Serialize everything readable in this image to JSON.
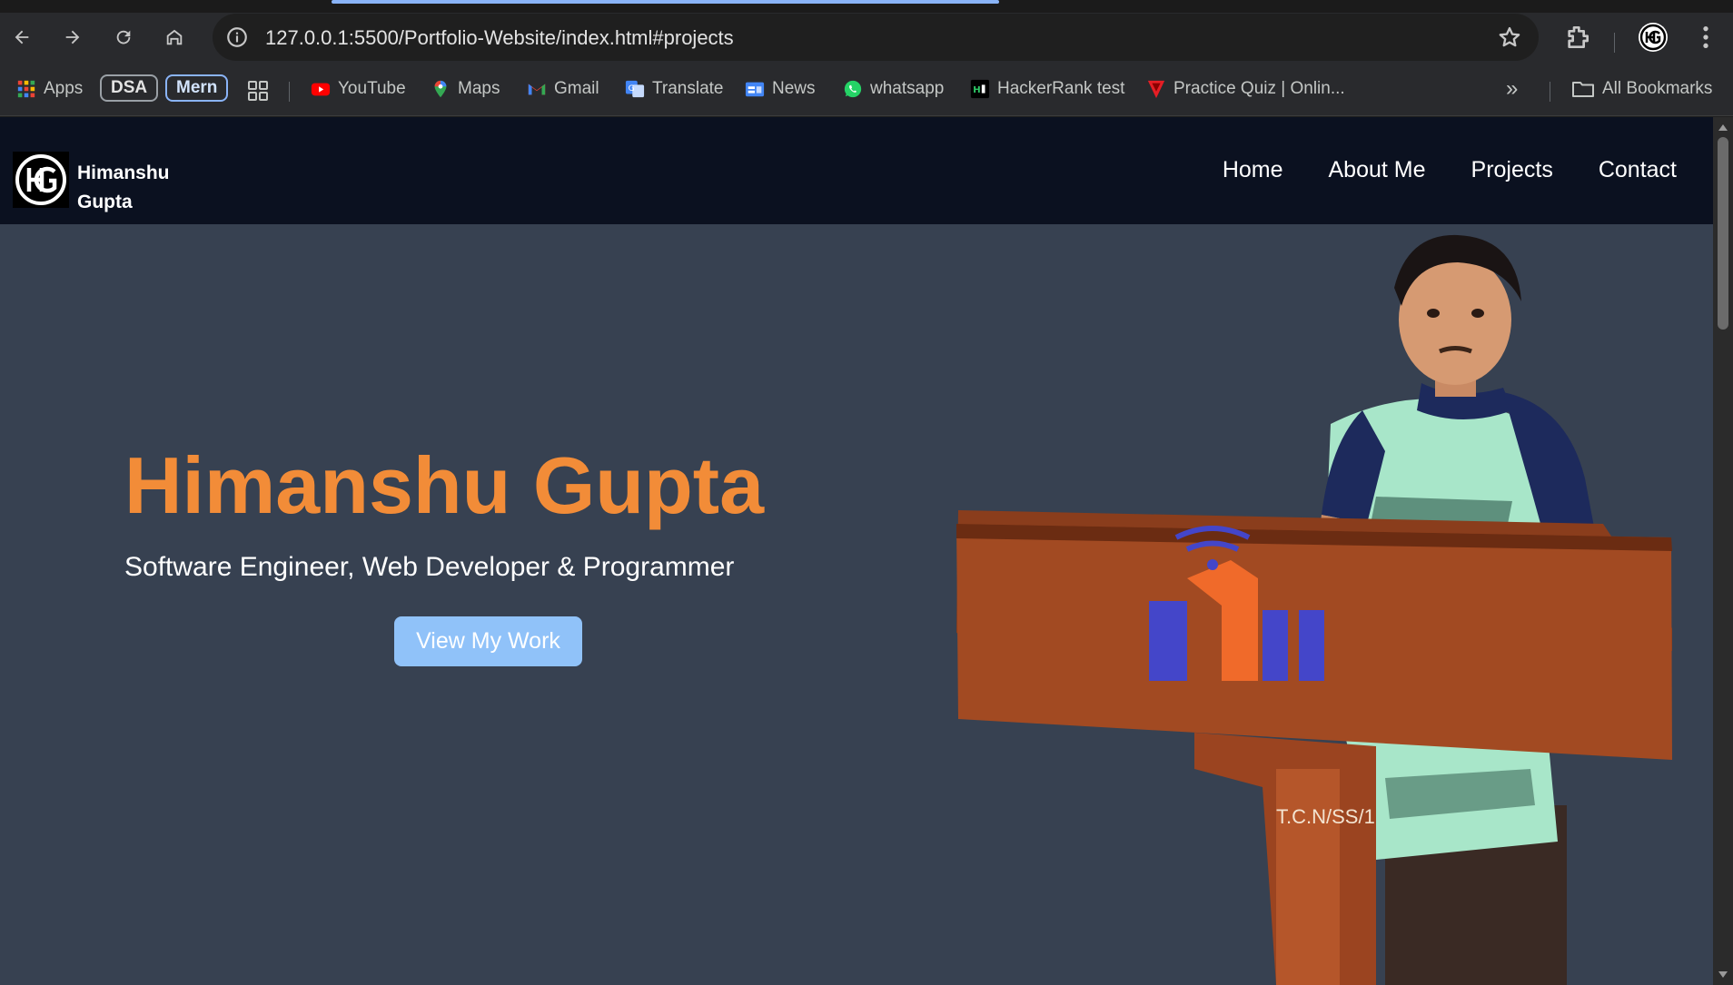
{
  "browser": {
    "url": "127.0.0.1:5500/Portfolio-Website/index.html#projects",
    "bookmarks": [
      {
        "label": "Apps",
        "icon": "apps-grid-icon"
      },
      {
        "label": "DSA",
        "icon": ""
      },
      {
        "label": "Mern",
        "icon": ""
      },
      {
        "label": "YouTube",
        "icon": "youtube-icon"
      },
      {
        "label": "Maps",
        "icon": "maps-pin-icon"
      },
      {
        "label": "Gmail",
        "icon": "gmail-icon"
      },
      {
        "label": "Translate",
        "icon": "translate-icon"
      },
      {
        "label": "News",
        "icon": "news-icon"
      },
      {
        "label": "whatsapp",
        "icon": "whatsapp-icon"
      },
      {
        "label": "HackerRank test",
        "icon": "hackerrank-icon"
      },
      {
        "label": "Practice Quiz | Onlin...",
        "icon": "quiz-icon"
      }
    ],
    "all_bookmarks": "All Bookmarks"
  },
  "site": {
    "brand_line1": "Himanshu",
    "brand_line2": "Gupta",
    "nav": [
      "Home",
      "About Me",
      "Projects",
      "Contact"
    ],
    "hero_title": "Himanshu Gupta",
    "hero_subtitle": "Software Engineer, Web Developer & Programmer",
    "cta": "View My Work",
    "podium_text": "T.C.N/SS/1"
  },
  "colors": {
    "header_bg": "#0b1120",
    "page_bg": "#374151",
    "accent_orange": "#f28c38",
    "button_blue": "#90c2f9"
  }
}
